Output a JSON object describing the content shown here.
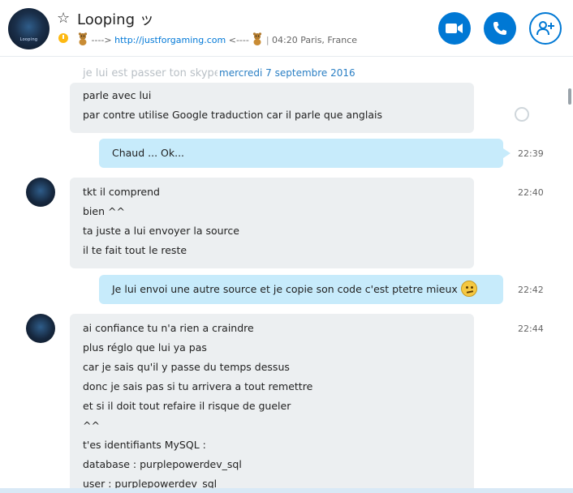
{
  "header": {
    "title": "Looping ッ",
    "avatar_text": "Looping",
    "mood_prefix": "----> ",
    "mood_link": "http://justforgaming.com",
    "mood_suffix": " <----",
    "location_sep": "|",
    "location": "04:20 Paris, France",
    "buttons": [
      "video-call",
      "audio-call",
      "add-people"
    ],
    "accent_color": "#0078d4"
  },
  "chat": {
    "faded_text": "je lui est passer ton skype",
    "date_separator": "mercredi 7 septembre 2016",
    "messages": [
      {
        "dir": "in",
        "lines": [
          "parle avec lui",
          "par contre utilise Google traduction car il parle que anglais"
        ],
        "time": ""
      },
      {
        "dir": "out",
        "lines": [
          "Chaud ... Ok..."
        ],
        "time": "22:39"
      },
      {
        "dir": "in",
        "lines": [
          "tkt il comprend",
          "bien ^^",
          "ta juste a lui envoyer la source",
          "il te fait tout le reste"
        ],
        "time": "22:40"
      },
      {
        "dir": "out",
        "lines": [
          "Je lui envoi une autre source et je copie son code c'est ptetre mieux"
        ],
        "time": "22:42",
        "emoji": "confused-face"
      },
      {
        "dir": "in",
        "lines": [
          "ai confiance tu n'a rien a craindre",
          "plus réglo que lui ya pas",
          "car je sais qu'il y passe du temps dessus",
          "donc je sais pas si tu arrivera a tout remettre",
          "et si il doit tout refaire il risque de gueler",
          "^^",
          "t'es identifiants MySQL :",
          "database : purplepowerdev_sql",
          "user : purplepowerdev_sql"
        ],
        "time": "22:44"
      }
    ]
  }
}
